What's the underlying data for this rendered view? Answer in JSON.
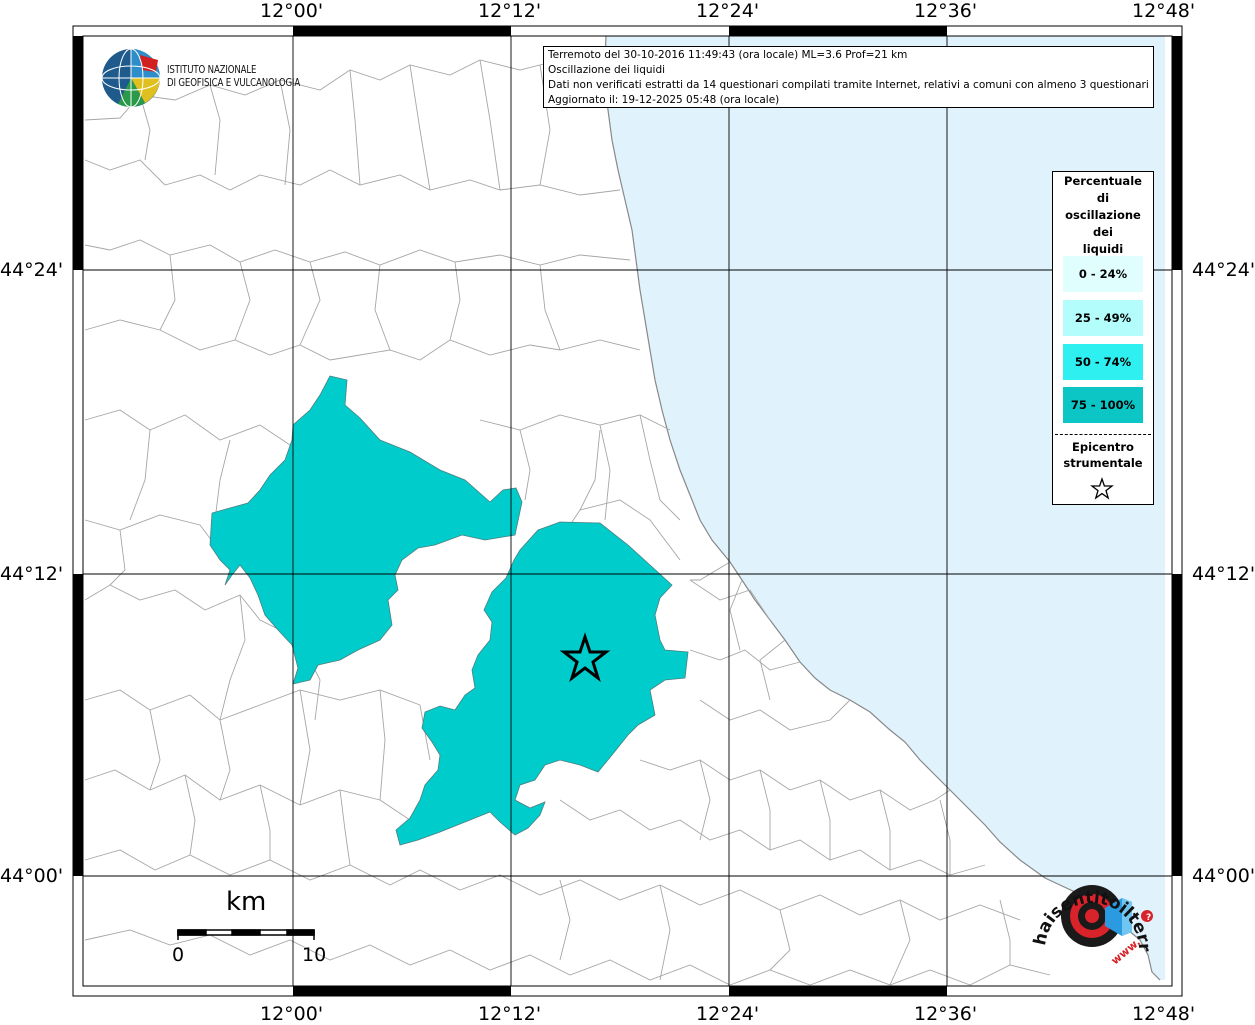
{
  "info": {
    "line1": "Terremoto del 30-10-2016 11:49:43 (ora locale) ML=3.6 Prof=21 km",
    "line2": "Oscillazione dei liquidi",
    "line3": "Dati non verificati estratti da 14 questionari compilati tramite Internet, relativi a comuni con almeno 3 questionari.",
    "line4": "Aggiornato il: 19-12-2025 05:48 (ora locale)"
  },
  "logo": {
    "line1": "ISTITUTO NAZIONALE",
    "line2": "DI GEOFISICA E VULCANOLOGIA",
    "badge_text": "haisentitoilterremoto.it",
    "badge_url": "www."
  },
  "axes": {
    "lon_top": [
      "12°00'",
      "12°12'",
      "12°24'",
      "12°36'",
      "12°48'"
    ],
    "lon_bottom": [
      "12°00'",
      "12°12'",
      "12°24'",
      "12°36'",
      "12°48'"
    ],
    "lat_left": [
      "44°24'",
      "44°12'",
      "44°00'"
    ],
    "lat_right": [
      "44°24'",
      "44°12'",
      "44°00'"
    ]
  },
  "legend": {
    "title_lines": [
      "Percentuale",
      "di",
      "oscillazione",
      "dei",
      "liquidi"
    ],
    "classes": [
      {
        "label": "0 - 24%",
        "color": "#e0fefe"
      },
      {
        "label": "25 - 49%",
        "color": "#b4fdfd"
      },
      {
        "label": "50 - 74%",
        "color": "#2ef0f0"
      },
      {
        "label": "75 - 100%",
        "color": "#0cc6c6"
      }
    ],
    "epicenter_lines": [
      "Epicentro",
      "strumentale"
    ]
  },
  "scale": {
    "unit": "km",
    "min": "0",
    "max": "10"
  },
  "colors": {
    "sea": "#e0f3fd",
    "land": "#ffffff",
    "filled_area": "#00cccc",
    "borders": "#9a9a9a"
  },
  "affected_area_class": "75 - 100%"
}
